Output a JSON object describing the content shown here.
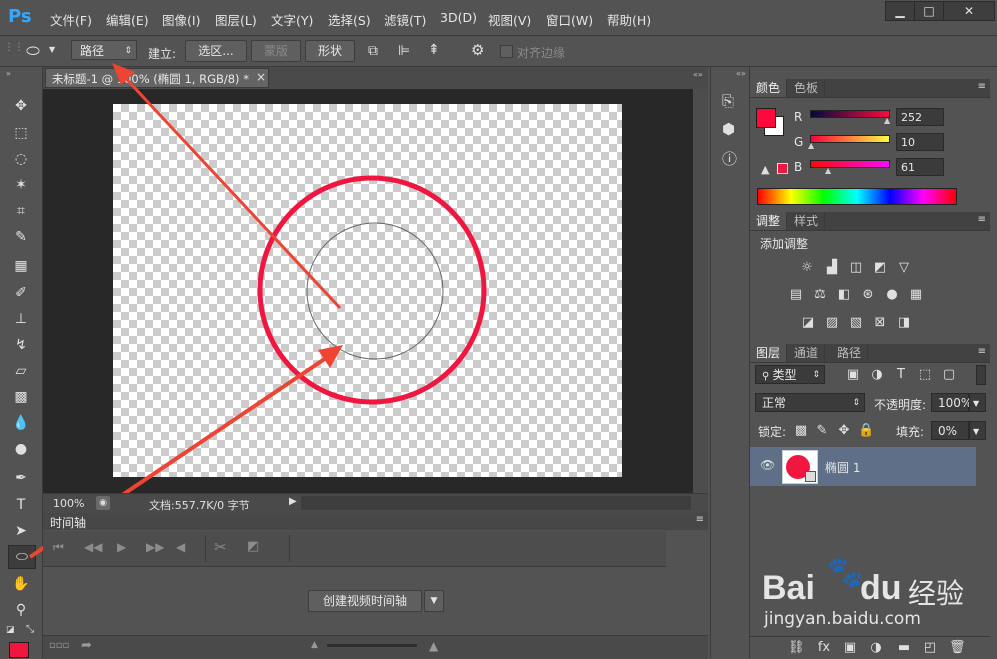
{
  "app": {
    "logo": "Ps"
  },
  "menu": [
    "文件(F)",
    "编辑(E)",
    "图像(I)",
    "图层(L)",
    "文字(Y)",
    "选择(S)",
    "滤镜(T)",
    "3D(D)",
    "视图(V)",
    "窗口(W)",
    "帮助(H)"
  ],
  "window_controls": {
    "minimize": "▁",
    "maximize": "□",
    "close": "✕"
  },
  "options": {
    "mode_select": "路径",
    "make_label": "建立:",
    "selection_btn": "选区...",
    "mask_btn": "蒙版",
    "shape_btn": "形状",
    "align_edges_label": "对齐边缘"
  },
  "document": {
    "tab_title": "未标题-1 @ 100% (椭圆 1, RGB/8) *",
    "tab_close": "×",
    "zoom": "100%",
    "doc_info": "文档:557.7K/0 字节"
  },
  "timeline": {
    "title": "时间轴",
    "create_button": "创建视频时间轴"
  },
  "color_panel": {
    "tabs": [
      "颜色",
      "色板"
    ],
    "r_label": "R",
    "g_label": "G",
    "b_label": "B",
    "r": "252",
    "g": "10",
    "b": "61",
    "foreground": "#fc0a3d",
    "background": "#ffffff"
  },
  "adjust_panel": {
    "tabs": [
      "调整",
      "样式"
    ],
    "heading": "添加调整"
  },
  "layers_panel": {
    "tabs": [
      "图层",
      "通道",
      "路径"
    ],
    "filter_label": "类型",
    "blend_mode": "正常",
    "opacity_label": "不透明度:",
    "opacity": "100%",
    "lock_label": "锁定:",
    "fill_label": "填充:",
    "fill": "0%",
    "layers": [
      {
        "name": "椭圆 1",
        "visible": true,
        "color": "#f0163f"
      }
    ]
  },
  "watermark": {
    "brand_a": "Bai",
    "brand_b": "du",
    "cn": "经验",
    "url": "jingyan.baidu.com"
  },
  "colors": {
    "accent_red": "#f0163f",
    "arrow_red": "#ee4433",
    "ps_blue": "#31a8ff"
  }
}
